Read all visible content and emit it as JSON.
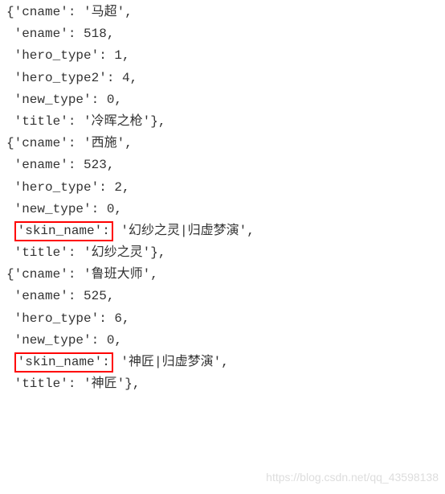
{
  "lines": [
    {
      "indent": 0,
      "text": "{'cname': '马超',",
      "highlight": false
    },
    {
      "indent": 1,
      "text": "'ename': 518,",
      "highlight": false
    },
    {
      "indent": 1,
      "text": "'hero_type': 1,",
      "highlight": false
    },
    {
      "indent": 1,
      "text": "'hero_type2': 4,",
      "highlight": false
    },
    {
      "indent": 1,
      "text": "'new_type': 0,",
      "highlight": false
    },
    {
      "indent": 1,
      "text": "'title': '冷晖之枪'},",
      "highlight": false
    },
    {
      "indent": 0,
      "text": "{'cname': '西施',",
      "highlight": false
    },
    {
      "indent": 1,
      "text": "'ename': 523,",
      "highlight": false
    },
    {
      "indent": 1,
      "text": "'hero_type': 2,",
      "highlight": false
    },
    {
      "indent": 1,
      "text": "'new_type': 0,",
      "highlight": false
    },
    {
      "indent": 1,
      "text": "'skin_name':",
      "after": " '幻纱之灵|归虚梦演',",
      "highlight": true
    },
    {
      "indent": 1,
      "text": "'title': '幻纱之灵'},",
      "highlight": false
    },
    {
      "indent": 0,
      "text": "{'cname': '鲁班大师',",
      "highlight": false
    },
    {
      "indent": 1,
      "text": "'ename': 525,",
      "highlight": false
    },
    {
      "indent": 1,
      "text": "'hero_type': 6,",
      "highlight": false
    },
    {
      "indent": 1,
      "text": "'new_type': 0,",
      "highlight": false
    },
    {
      "indent": 1,
      "text": "'skin_name':",
      "after": " '神匠|归虚梦演',",
      "highlight": true
    },
    {
      "indent": 1,
      "text": "'title': '神匠'},",
      "highlight": false
    }
  ],
  "watermark": "https://blog.csdn.net/qq_43598138"
}
